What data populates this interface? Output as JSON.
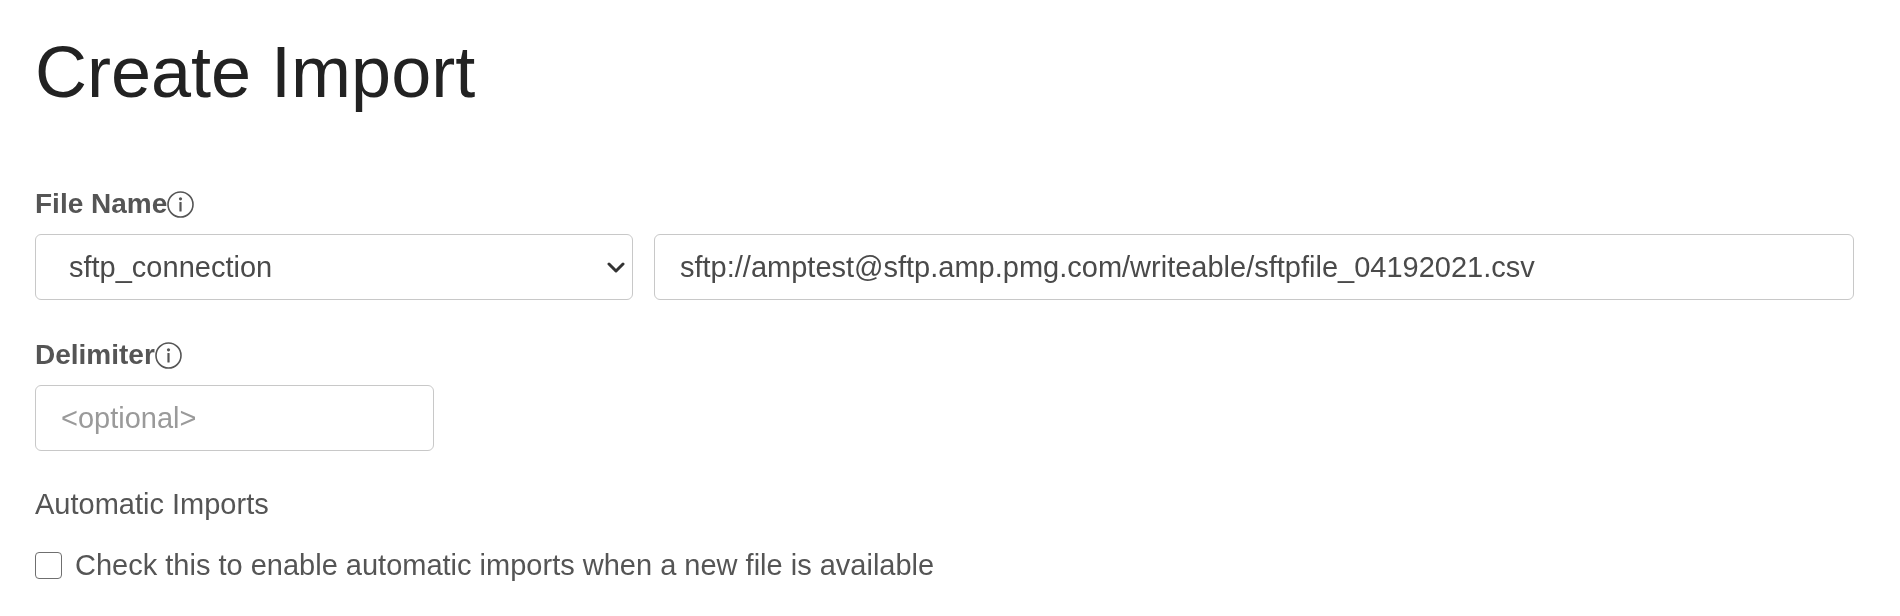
{
  "title": "Create Import",
  "file_name": {
    "label": "File Name",
    "connection_select": {
      "value": "sftp_connection"
    },
    "path_field": {
      "value": "sftp://amptest@sftp.amp.pmg.com/writeable/sftpfile_04192021.csv"
    }
  },
  "delimiter": {
    "label": "Delimiter",
    "field": {
      "placeholder": "<optional>"
    }
  },
  "automatic_imports": {
    "label": "Automatic Imports",
    "checkbox": {
      "label": "Check this to enable automatic imports when a new file is available",
      "checked": false
    }
  }
}
